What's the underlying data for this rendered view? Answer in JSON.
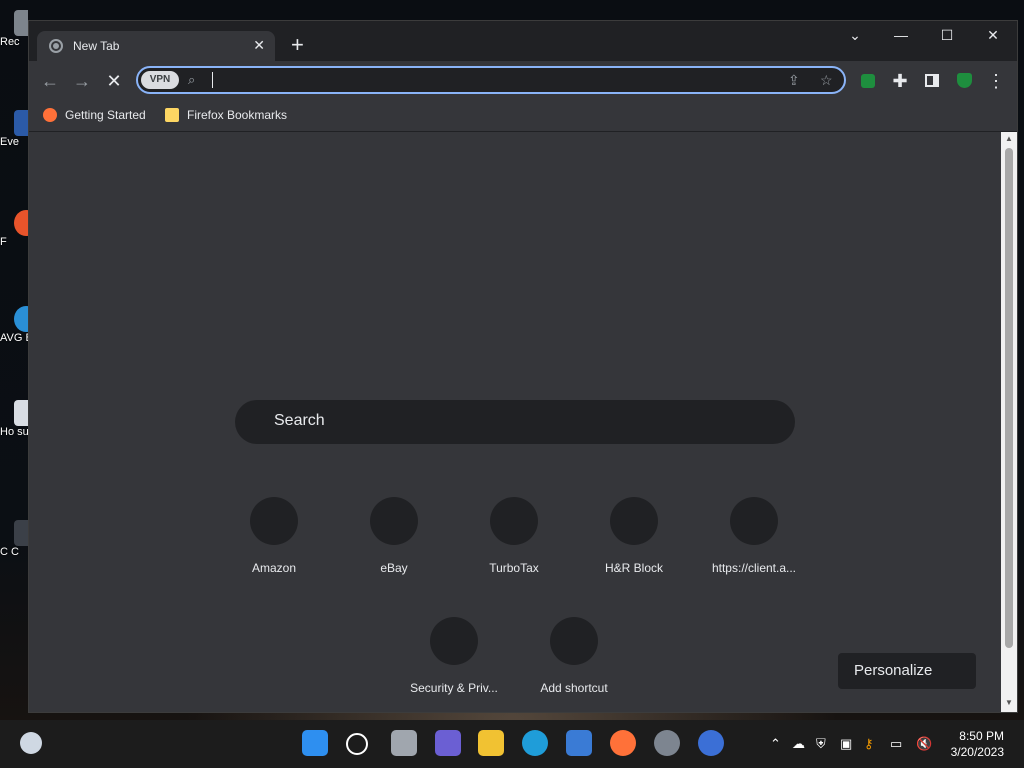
{
  "desktop": {
    "icons": [
      {
        "label": "Rec"
      },
      {
        "label": "Eve"
      },
      {
        "label": "F"
      },
      {
        "label": "AVG Br"
      },
      {
        "label": "Ho susp"
      },
      {
        "label": "C C"
      }
    ]
  },
  "browser": {
    "tab": {
      "title": "New Tab",
      "close_icon": "close-icon"
    },
    "new_tab_symbol": "+",
    "window_controls": {
      "dropdown": "⌄",
      "minimize": "—",
      "maximize": "☐",
      "close": "✕"
    },
    "toolbar": {
      "back": "←",
      "forward": "→",
      "stop": "✕",
      "vpn_label": "VPN",
      "address_value": "",
      "share": "⇪",
      "star": "☆",
      "menu": "⋮"
    },
    "bookmarks": [
      {
        "label": "Getting Started",
        "icon": "firefox-icon"
      },
      {
        "label": "Firefox Bookmarks",
        "icon": "folder-icon"
      }
    ]
  },
  "newtab": {
    "search_placeholder": "Search",
    "shortcuts_row1": [
      {
        "label": "Amazon"
      },
      {
        "label": "eBay"
      },
      {
        "label": "TurboTax"
      },
      {
        "label": "H&R Block"
      },
      {
        "label": "https://client.a..."
      }
    ],
    "shortcuts_row2": [
      {
        "label": "Security & Priv..."
      },
      {
        "label": "Add shortcut"
      }
    ],
    "personalize_label": "Personalize"
  },
  "taskbar": {
    "time": "8:50 PM",
    "date": "3/20/2023"
  },
  "colors": {
    "accent": "#8ab4f8",
    "content_bg": "#35363a",
    "frame_bg": "#202124"
  }
}
